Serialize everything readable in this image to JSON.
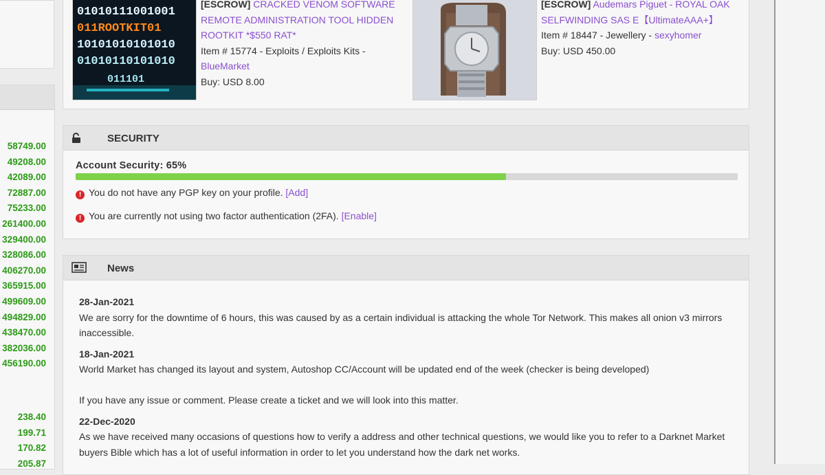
{
  "sidebar": {
    "values_top": [
      "58749.00",
      "49208.00",
      "42089.00",
      "72887.00",
      "75233.00",
      "261400.00",
      "329400.00",
      "328086.00",
      "406270.00",
      "365915.00",
      "499609.00",
      "494829.00",
      "438470.00",
      "382036.00",
      "456190.00"
    ],
    "values_bottom": [
      "238.40",
      "199.71",
      "170.82",
      "205.87"
    ],
    "value_color": "#2c9a16"
  },
  "products": [
    {
      "tag": "[ESCROW]",
      "title": "CRACKED VENOM SOFTWARE REMOTE ADMINISTRATION TOOL HIDDEN ROOTKIT *$550 RAT*",
      "item_line": "Item # 15774 - Exploits / Exploits Kits -",
      "vendor": "BlueMarket",
      "price": "Buy: USD 8.00",
      "image_rows": [
        "01010111001001",
        "011ROOTKIT01",
        "10101010101010",
        "01010110101010",
        "011101"
      ]
    },
    {
      "tag": "[ESCROW]",
      "title": "Audemars Piguet - ROYAL OAK SELFWINDING SAS E【UltimateAAA+】",
      "item_line": "Item # 18447 - Jewellery -",
      "vendor": "sexyhomer",
      "price": "Buy: USD 450.00"
    }
  ],
  "security": {
    "title": "SECURITY",
    "icon": "unlock-icon",
    "label": "Account Security: 65%",
    "progress": 0.65,
    "alerts": [
      {
        "text": "You do not have any PGP key on your profile.",
        "action": "[Add]"
      },
      {
        "text": "You are currently not using two factor authentication (2FA).",
        "action": "[Enable]"
      }
    ]
  },
  "news": {
    "title": "News",
    "icon": "newspaper-icon",
    "items": [
      {
        "date": "28-Jan-2021",
        "lines": [
          "We are sorry for the downtime of 6 hours, this was caused by as a certain individual is attacking the whole Tor Network. This makes all onion v3 mirrors inaccessible."
        ]
      },
      {
        "date": "18-Jan-2021",
        "lines": [
          "World Market has changed its layout and system, Autoshop CC/Account will be updated end of the week (checker is being developed)",
          "If you have any issue or comment. Please create a ticket and we will look into this matter."
        ]
      },
      {
        "date": "22-Dec-2020",
        "lines": [
          "As we have received many occasions of questions how to verify a address and other technical questions, we would like you to refer to a Darknet Market buyers Bible which has a lot of useful information in order to let you understand how the dark net works."
        ]
      }
    ]
  },
  "colors": {
    "link": "#8a4fcf",
    "progress": "#7fd14a",
    "alert": "#d9262b"
  }
}
